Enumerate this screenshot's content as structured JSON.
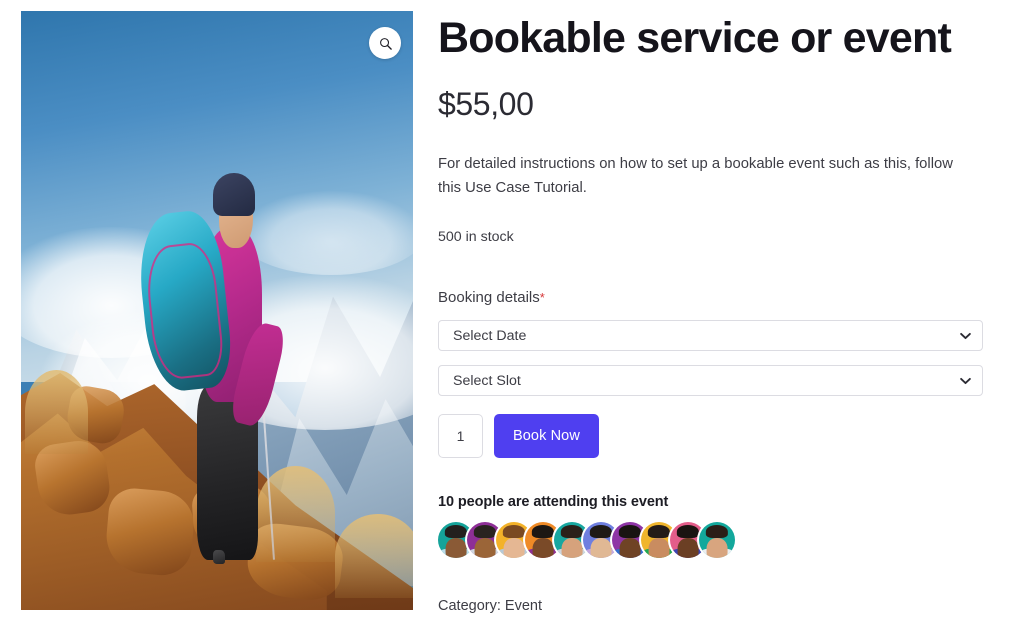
{
  "gallery": {
    "zoom_icon": "search-icon",
    "image_alt": "hiker-with-backpack-on-mountain-ridge"
  },
  "product": {
    "title": "Bookable service or event",
    "price": "$55,00",
    "description": "For detailed instructions on how to set up a bookable event such as this, follow this Use Case Tutorial.",
    "stock_status": "500 in stock",
    "category": "Category: Event"
  },
  "booking": {
    "label": "Booking details",
    "required_marker": "*",
    "date_select": {
      "value": "Select Date",
      "options": [
        "Select Date"
      ]
    },
    "slot_select": {
      "value": "Select Slot",
      "options": [
        "Select Slot"
      ]
    },
    "quantity": "1",
    "submit_label": "Book Now"
  },
  "attendance": {
    "text": "10 people are attending this event",
    "count": 10,
    "avatars": [
      {
        "bg": "#15a39a",
        "skin": "#8a5a36",
        "hair": "#23201e",
        "shirt": "#b9dce9"
      },
      {
        "bg": "#8e2f97",
        "skin": "#9b6538",
        "hair": "#2a2320",
        "shirt": "#cfd6de"
      },
      {
        "bg": "#f3b229",
        "skin": "#e5b793",
        "hair": "#7a4a22",
        "shirt": "#b6c9d8"
      },
      {
        "bg": "#ef8a26",
        "skin": "#7a4a28",
        "hair": "#1d1713",
        "shirt": "#8e2f97"
      },
      {
        "bg": "#18a7a0",
        "skin": "#d6a27c",
        "hair": "#2b2019",
        "shirt": "#cfd6de"
      },
      {
        "bg": "#6f7fe0",
        "skin": "#e0b894",
        "hair": "#1f1a17",
        "shirt": "#c4a8de"
      },
      {
        "bg": "#8e35a6",
        "skin": "#6f4325",
        "hair": "#191412",
        "shirt": "#2f6fd0"
      },
      {
        "bg": "#f0b52c",
        "skin": "#c98c60",
        "hair": "#241c17",
        "shirt": "#1faa54"
      },
      {
        "bg": "#e35d8a",
        "skin": "#6b3f24",
        "hair": "#1a1411",
        "shirt": "#3b45b5"
      },
      {
        "bg": "#13a89c",
        "skin": "#d8a57f",
        "hair": "#2a1f18",
        "shirt": "#eceef1"
      }
    ]
  },
  "colors": {
    "accent": "#4f3ff0",
    "required": "#d63638",
    "border": "#dcdce2",
    "title": "#15141b",
    "body_text": "#3d3d45"
  }
}
